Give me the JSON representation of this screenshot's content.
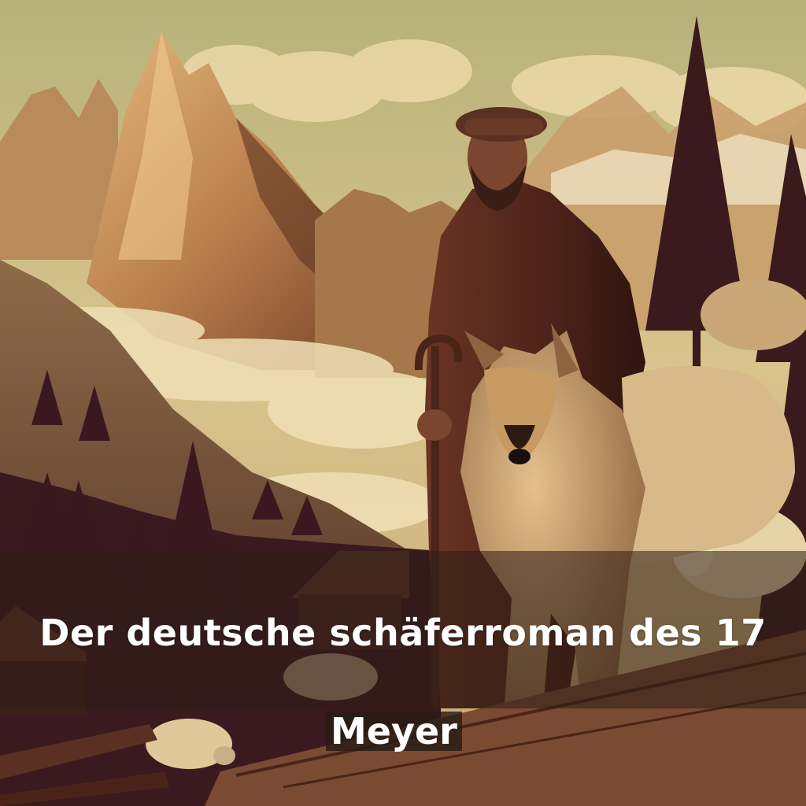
{
  "cover": {
    "title": "Der deutsche schäferroman des 17",
    "author": "Meyer"
  },
  "palette": {
    "sky": "#d9c48a",
    "mountain_light": "#d2a46a",
    "mountain_dark": "#7a4a2c",
    "forest": "#3e1a22",
    "coat": "#5a2e20",
    "dog_fur": "#c9a06a",
    "sheep": "#e6d3a6",
    "band": "#2d1e16",
    "text": "#ffffff"
  }
}
